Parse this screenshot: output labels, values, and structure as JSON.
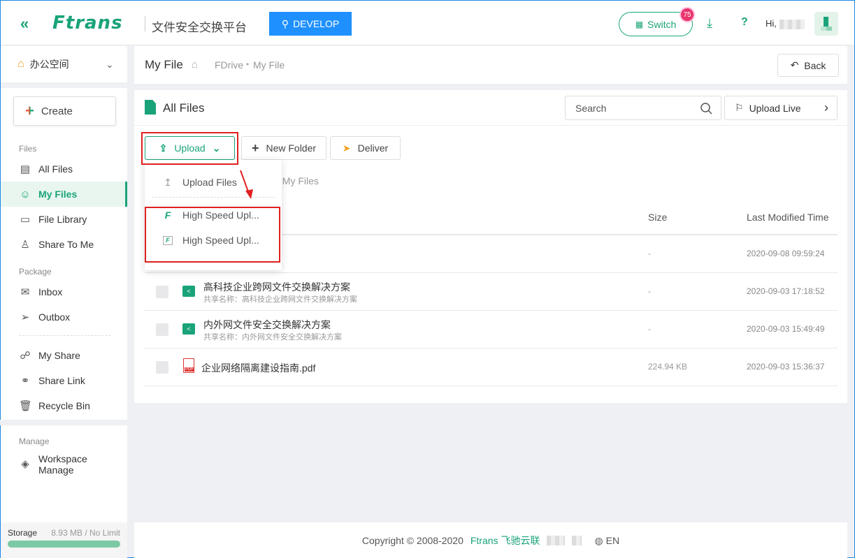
{
  "header": {
    "logo": "Ftrans",
    "platform": "文件安全交换平台",
    "env_label": "DEVELOP",
    "switch_label": "Switch",
    "notifications": "75",
    "help": "?",
    "greeting": "Hi,"
  },
  "sidebar": {
    "workspace": "办公空间",
    "create": "Create",
    "sections": {
      "files": "Files",
      "package": "Package",
      "manage": "Manage"
    },
    "items": [
      {
        "label": "All Files"
      },
      {
        "label": "My Files"
      },
      {
        "label": "File Library"
      },
      {
        "label": "Share To Me"
      },
      {
        "label": "Inbox"
      },
      {
        "label": "Outbox"
      },
      {
        "label": "My Share"
      },
      {
        "label": "Share Link"
      },
      {
        "label": "Recycle Bin"
      },
      {
        "label": "Workspace Manage"
      }
    ],
    "storage_label": "Storage",
    "storage_value": "8.93 MB / No Limit"
  },
  "breadcrumb": {
    "title": "My File",
    "path1": "FDrive",
    "path2": "My File",
    "back": "Back"
  },
  "main": {
    "title": "All Files",
    "search_placeholder": "Search",
    "upload_live": "Upload Live",
    "upload": "Upload",
    "new_folder": "New Folder",
    "deliver": "Deliver",
    "path_current": "/ My Files",
    "columns": {
      "size": "Size",
      "modified": "Last Modified Time"
    },
    "rows": [
      {
        "name": "",
        "share": "",
        "size": "-",
        "modified": "2020-09-08 09:59:24"
      },
      {
        "name": "高科技企业跨网文件交换解决方案",
        "share": "共享名称：高科技企业跨网文件交换解决方案",
        "size": "-",
        "modified": "2020-09-03 17:18:52"
      },
      {
        "name": "内外网文件安全交换解决方案",
        "share": "共享名称：内外网文件安全交换解决方案",
        "size": "-",
        "modified": "2020-09-03 15:49:49"
      },
      {
        "name": "企业网络隔离建设指南.pdf",
        "share": "",
        "size": "224.94 KB",
        "modified": "2020-09-03 15:36:37"
      }
    ]
  },
  "upload_menu": {
    "upload_files": "Upload Files",
    "high_speed_1": "High Speed Upl...",
    "high_speed_2": "High Speed Upl..."
  },
  "footer": {
    "copyright": "Copyright © 2008-2020",
    "brand": "Ftrans 飞驰云联",
    "lang": "EN"
  },
  "colors": {
    "brand_green": "#1aa37a",
    "develop_blue": "#1e90ff",
    "highlight_red": "#e02020"
  }
}
